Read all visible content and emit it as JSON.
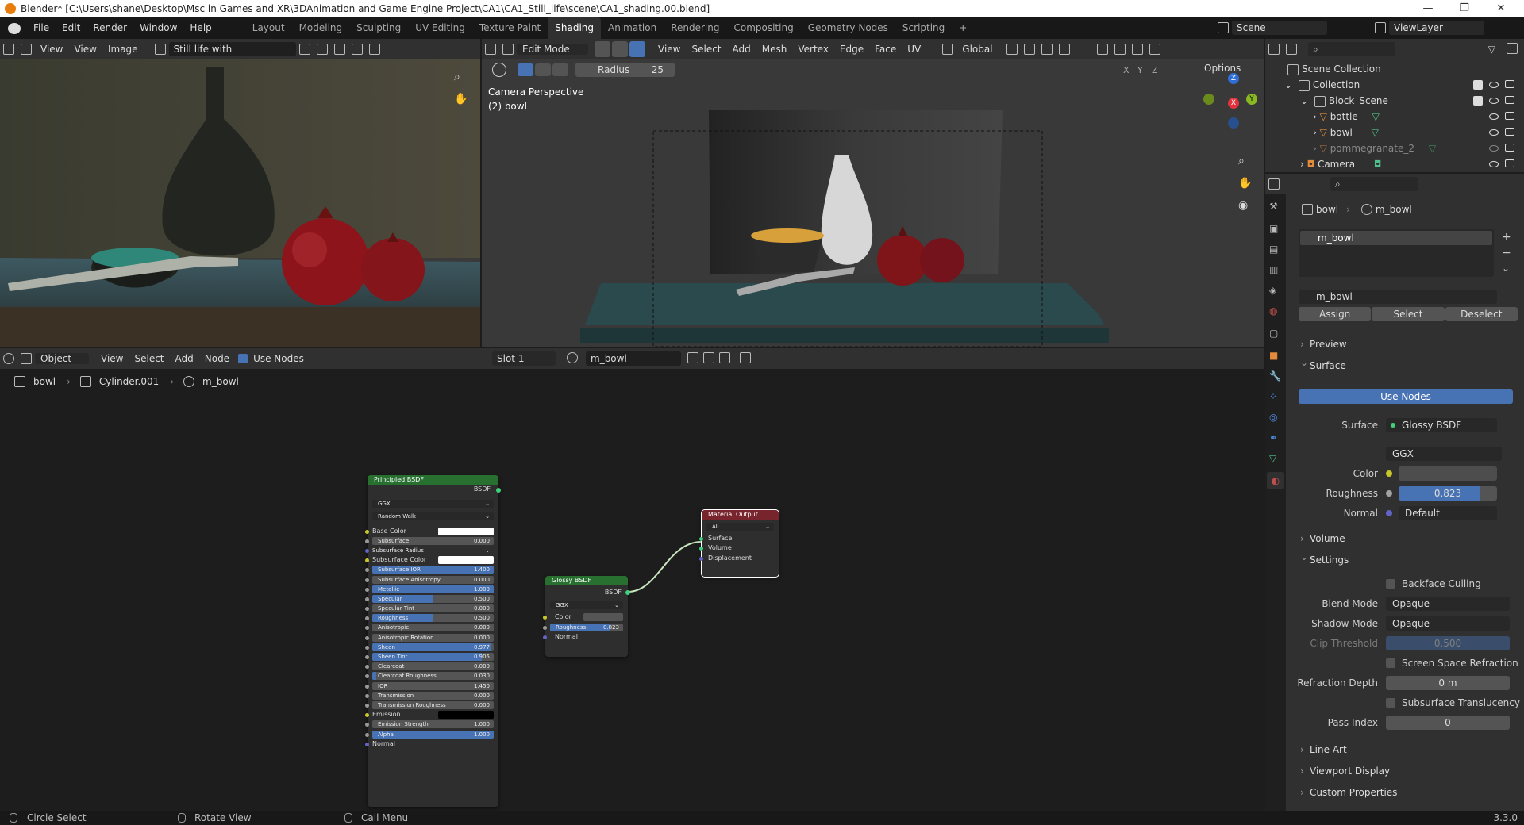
{
  "window": {
    "title": "Blender* [C:\\Users\\shane\\Desktop\\Msc in Games and XR\\3DAnimation  and Game Engine Project\\CA1\\CA1_Still_life\\scene\\CA1_shading.00.blend]",
    "controls": [
      "—",
      "❐",
      "✕"
    ]
  },
  "menu": [
    "File",
    "Edit",
    "Render",
    "Window",
    "Help"
  ],
  "workspaces": [
    "Layout",
    "Modeling",
    "Sculpting",
    "UV Editing",
    "Texture Paint",
    "Shading",
    "Animation",
    "Rendering",
    "Compositing",
    "Geometry Nodes",
    "Scripting",
    "+"
  ],
  "active_workspace": "Shading",
  "scene": {
    "name": "Scene",
    "view_layer": "ViewLayer"
  },
  "image_editor": {
    "menus": [
      "View",
      "View",
      "Image"
    ],
    "image_name": "Still life with pomegranates.jpg"
  },
  "viewport": {
    "mode": "Edit Mode",
    "menus": [
      "View",
      "Select",
      "Add",
      "Mesh",
      "Vertex",
      "Edge",
      "Face",
      "UV"
    ],
    "orientation": "Global",
    "tool_label": "Radius",
    "tool_value": "25",
    "options": "Options",
    "overlay_title": "Camera Perspective",
    "overlay_object": "(2) bowl",
    "axes": [
      "X",
      "Y",
      "Z"
    ]
  },
  "node_editor": {
    "mode": "Object",
    "menus": [
      "View",
      "Select",
      "Add",
      "Node"
    ],
    "use_nodes": "Use Nodes",
    "slot": "Slot 1",
    "material": "m_bowl",
    "breadcrumb": [
      "bowl",
      "Cylinder.001",
      "m_bowl"
    ]
  },
  "principled": {
    "title": "Principled BSDF",
    "output": "BSDF",
    "dists": [
      "GGX",
      "Random Walk"
    ],
    "rows": [
      {
        "label": "Base Color",
        "type": "color",
        "color": "#ffffff"
      },
      {
        "label": "Subsurface",
        "value": "0.000",
        "fill": 0
      },
      {
        "label": "Subsurface Radius",
        "type": "dropdown"
      },
      {
        "label": "Subsurface Color",
        "type": "color",
        "color": "#ffffff"
      },
      {
        "label": "Subsurface IOR",
        "value": "1.400",
        "fill": 1
      },
      {
        "label": "Subsurface Anisotropy",
        "value": "0.000",
        "fill": 0
      },
      {
        "label": "Metallic",
        "value": "1.000",
        "fill": 1
      },
      {
        "label": "Specular",
        "value": "0.500",
        "fill": 0.5
      },
      {
        "label": "Specular Tint",
        "value": "0.000",
        "fill": 0
      },
      {
        "label": "Roughness",
        "value": "0.500",
        "fill": 0.5
      },
      {
        "label": "Anisotropic",
        "value": "0.000",
        "fill": 0
      },
      {
        "label": "Anisotropic Rotation",
        "value": "0.000",
        "fill": 0
      },
      {
        "label": "Sheen",
        "value": "0.977",
        "fill": 0.977
      },
      {
        "label": "Sheen Tint",
        "value": "0.905",
        "fill": 0.905
      },
      {
        "label": "Clearcoat",
        "value": "0.000",
        "fill": 0
      },
      {
        "label": "Clearcoat Roughness",
        "value": "0.030",
        "fill": 0.03
      },
      {
        "label": "IOR",
        "value": "1.450",
        "fill": 0
      },
      {
        "label": "Transmission",
        "value": "0.000",
        "fill": 0
      },
      {
        "label": "Transmission Roughness",
        "value": "0.000",
        "fill": 0
      },
      {
        "label": "Emission",
        "type": "color",
        "color": "#000000"
      },
      {
        "label": "Emission Strength",
        "value": "1.000",
        "fill": 0
      },
      {
        "label": "Alpha",
        "value": "1.000",
        "fill": 1
      },
      {
        "label": "Normal",
        "type": "plain"
      }
    ]
  },
  "glossy": {
    "title": "Glossy BSDF",
    "output": "BSDF",
    "dist": "GGX",
    "color_label": "Color",
    "rough_label": "Roughness",
    "rough_value": "0.823",
    "rough_fill": 0.823,
    "normal_label": "Normal"
  },
  "output_node": {
    "title": "Material Output",
    "target": "All",
    "sockets": [
      "Surface",
      "Volume",
      "Displacement"
    ]
  },
  "outliner": {
    "rows": [
      "Scene Collection",
      "Collection",
      "Block_Scene",
      "bottle",
      "bowl",
      "pommegranate_2",
      "Camera"
    ]
  },
  "properties": {
    "breadcrumb": [
      "bowl",
      "m_bowl"
    ],
    "slot": "m_bowl",
    "material": "m_bowl",
    "assign": "Assign",
    "select": "Select",
    "deselect": "Deselect",
    "sections": {
      "preview": "Preview",
      "surface": "Surface",
      "volume": "Volume",
      "settings": "Settings",
      "lineart": "Line Art",
      "viewport_display": "Viewport Display",
      "custom": "Custom Properties"
    },
    "use_nodes": "Use Nodes",
    "surface_label": "Surface",
    "surface_value": "Glossy BSDF",
    "dist": "GGX",
    "color_label": "Color",
    "rough_label": "Roughness",
    "rough_value": "0.823",
    "rough_fill": 0.823,
    "normal_label": "Normal",
    "normal_value": "Default",
    "backface": "Backface Culling",
    "blend_label": "Blend Mode",
    "blend_value": "Opaque",
    "shadow_label": "Shadow Mode",
    "shadow_value": "Opaque",
    "clip_label": "Clip Threshold",
    "clip_value": "0.500",
    "ssr": "Screen Space Refraction",
    "refr_label": "Refraction Depth",
    "refr_value": "0 m",
    "sst": "Subsurface Translucency",
    "pass_label": "Pass Index",
    "pass_value": "0"
  },
  "status": {
    "left": "Circle Select",
    "middle": "Rotate View",
    "right": "Call Menu",
    "version": "3.3.0"
  },
  "colors": {
    "accent": "#4772b3",
    "header": "#303030",
    "node_green": "#277030",
    "node_red": "#78242c"
  }
}
